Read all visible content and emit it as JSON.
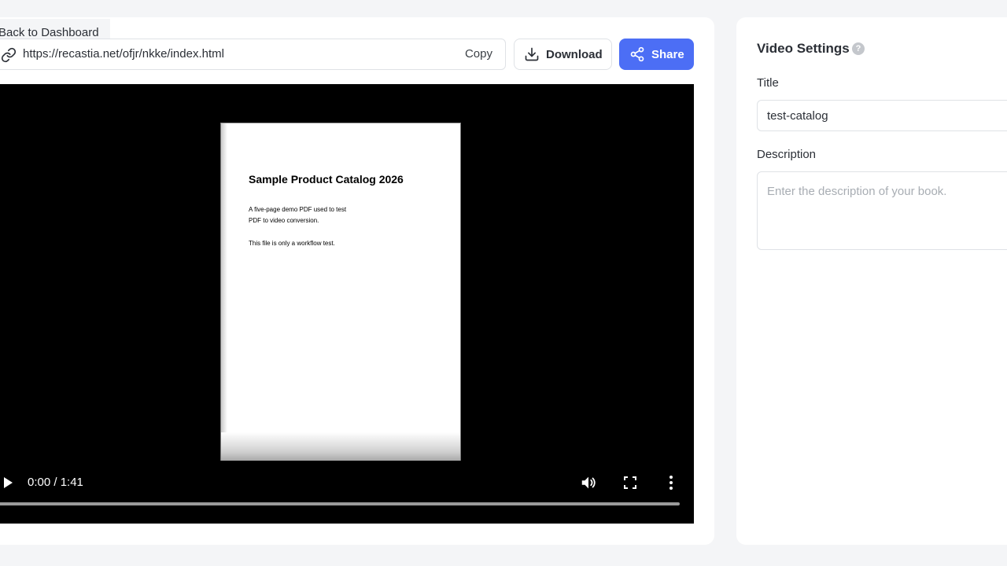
{
  "nav": {
    "back_label": "Back to Dashboard"
  },
  "share_bar": {
    "url": "https://recastia.net/ofjr/nkke/index.html",
    "copy_label": "Copy",
    "download_label": "Download",
    "share_label": "Share",
    "share_color": "#4c6ef5"
  },
  "video": {
    "page": {
      "title": "Sample Product Catalog 2026",
      "line1": "A five-page demo PDF used to test",
      "line2": "PDF to video conversion.",
      "line3": "This file is only a workflow test."
    },
    "time_display": "0:00 / 1:41",
    "progress_fraction": 0,
    "controls": [
      "play-icon",
      "volume-icon",
      "fullscreen-icon",
      "more-icon"
    ]
  },
  "settings": {
    "title": "Video Settings",
    "help_glyph": "?",
    "title_label": "Title",
    "title_value": "test-catalog",
    "description_label": "Description",
    "description_placeholder": "Enter the description of your book."
  }
}
